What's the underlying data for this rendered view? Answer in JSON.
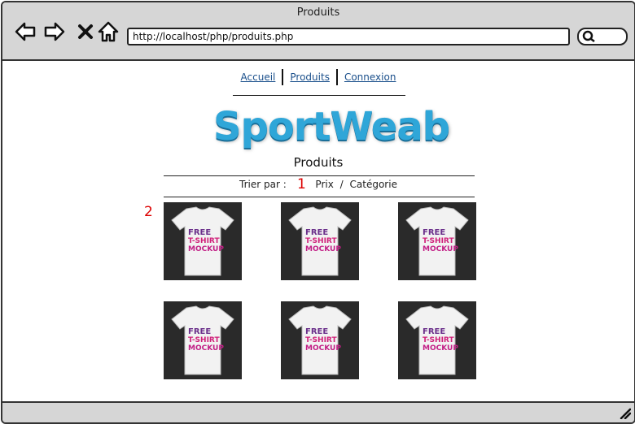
{
  "window": {
    "title": "Produits"
  },
  "toolbar": {
    "url": "http://localhost/php/produits.php",
    "back_icon": "back-arrow-icon",
    "forward_icon": "forward-arrow-icon",
    "stop_icon": "close-icon",
    "home_icon": "home-icon",
    "search_icon": "search-icon"
  },
  "menu": {
    "items": [
      {
        "label": "Accueil"
      },
      {
        "label": "Produits"
      },
      {
        "label": "Connexion"
      }
    ]
  },
  "logo": {
    "text": "SportWeab"
  },
  "page": {
    "title": "Produits"
  },
  "sort": {
    "label": "Trier par :",
    "options": [
      "Prix",
      "Catégorie"
    ],
    "separator": "/"
  },
  "annotations": {
    "marker_1": "1",
    "marker_2": "2"
  },
  "products": [
    {
      "line1": "FREE",
      "line2": "T-SHIRT",
      "line3": "MOCKUP"
    },
    {
      "line1": "FREE",
      "line2": "T-SHIRT",
      "line3": "MOCKUP"
    },
    {
      "line1": "FREE",
      "line2": "T-SHIRT",
      "line3": "MOCKUP"
    },
    {
      "line1": "FREE",
      "line2": "T-SHIRT",
      "line3": "MOCKUP"
    },
    {
      "line1": "FREE",
      "line2": "T-SHIRT",
      "line3": "MOCKUP"
    },
    {
      "line1": "FREE",
      "line2": "T-SHIRT",
      "line3": "MOCKUP"
    }
  ],
  "colors": {
    "link": "#1a4f8b",
    "marker": "#d00000",
    "logo": "#2fa6d8",
    "chrome": "#d6d6d6"
  }
}
